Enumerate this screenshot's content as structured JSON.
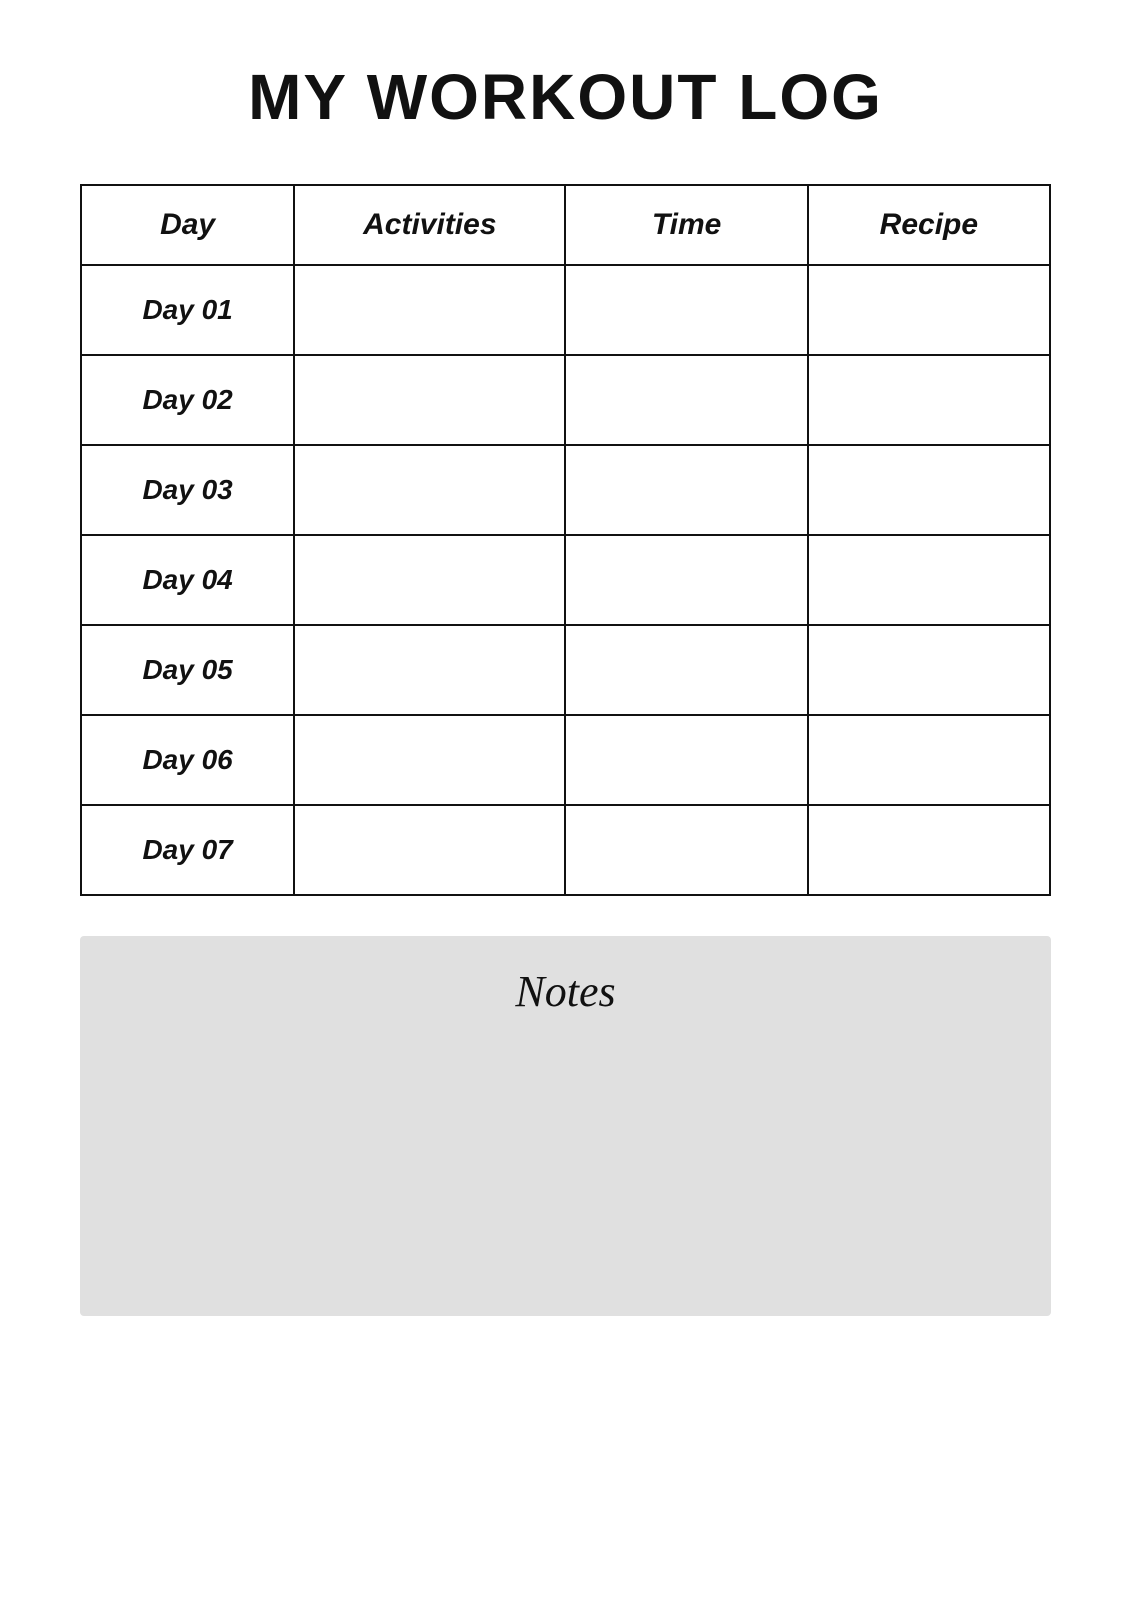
{
  "page": {
    "title": "MY WORKOUT LOG"
  },
  "table": {
    "headers": {
      "day": "Day",
      "activities": "Activities",
      "time": "Time",
      "recipe": "Recipe"
    },
    "rows": [
      {
        "day": "Day 01"
      },
      {
        "day": "Day 02"
      },
      {
        "day": "Day 03"
      },
      {
        "day": "Day 04"
      },
      {
        "day": "Day 05"
      },
      {
        "day": "Day 06"
      },
      {
        "day": "Day 07"
      }
    ]
  },
  "notes": {
    "title": "Notes"
  }
}
